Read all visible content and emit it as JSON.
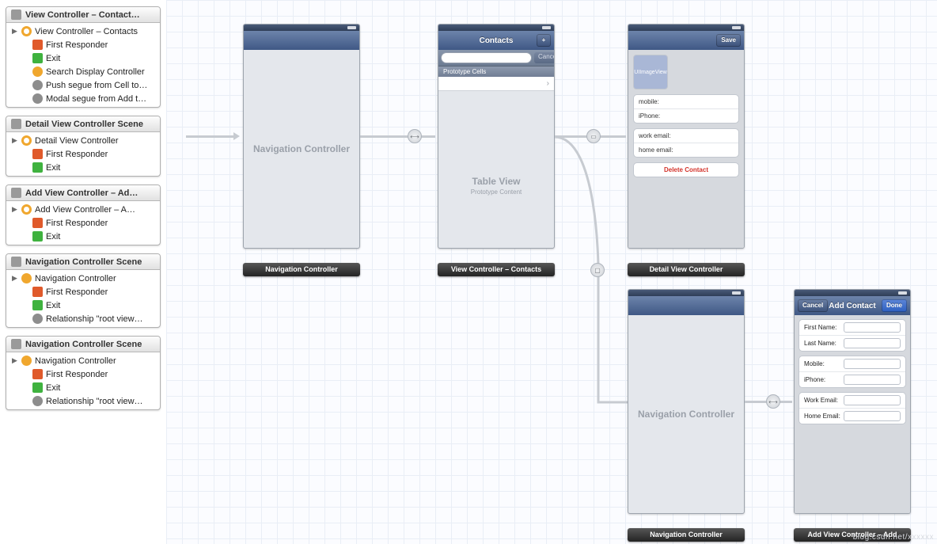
{
  "sidebar": {
    "scenes": [
      {
        "title": "View Controller – Contact…",
        "items": [
          {
            "icon": "vc",
            "label": "View Controller – Contacts",
            "tri": true
          },
          {
            "icon": "fr",
            "label": "First Responder"
          },
          {
            "icon": "exit",
            "label": "Exit"
          },
          {
            "icon": "search",
            "label": "Search Display Controller"
          },
          {
            "icon": "segue",
            "label": "Push segue from Cell to…"
          },
          {
            "icon": "segue",
            "label": "Modal segue from Add t…"
          }
        ]
      },
      {
        "title": "Detail View Controller Scene",
        "items": [
          {
            "icon": "vc",
            "label": "Detail View Controller",
            "tri": true
          },
          {
            "icon": "fr",
            "label": "First Responder"
          },
          {
            "icon": "exit",
            "label": "Exit"
          }
        ]
      },
      {
        "title": "Add View Controller – Ad…",
        "items": [
          {
            "icon": "vc",
            "label": "Add View Controller – A…",
            "tri": true
          },
          {
            "icon": "fr",
            "label": "First Responder"
          },
          {
            "icon": "exit",
            "label": "Exit"
          }
        ]
      },
      {
        "title": "Navigation Controller Scene",
        "items": [
          {
            "icon": "nav",
            "label": "Navigation Controller",
            "tri": true
          },
          {
            "icon": "fr",
            "label": "First Responder"
          },
          {
            "icon": "exit",
            "label": "Exit"
          },
          {
            "icon": "rel",
            "label": "Relationship \"root view…"
          }
        ]
      },
      {
        "title": "Navigation Controller Scene",
        "items": [
          {
            "icon": "nav",
            "label": "Navigation Controller",
            "tri": true
          },
          {
            "icon": "fr",
            "label": "First Responder"
          },
          {
            "icon": "exit",
            "label": "Exit"
          },
          {
            "icon": "rel",
            "label": "Relationship \"root view…"
          }
        ]
      }
    ]
  },
  "canvas": {
    "navController": {
      "placeholder": "Navigation Controller",
      "caption": "Navigation Controller"
    },
    "contacts": {
      "title": "Contacts",
      "plus": "+",
      "search_cancel": "Cancel",
      "proto_hdr": "Prototype Cells",
      "tv": "Table View",
      "tv_sub": "Prototype Content",
      "caption": "View Controller – Contacts",
      "chevron": "›"
    },
    "detail": {
      "save": "Save",
      "img": "UIImageView",
      "mobile": "mobile:",
      "iphone": "iPhone:",
      "work": "work email:",
      "home": "home email:",
      "delete": "Delete Contact",
      "caption": "Detail View Controller"
    },
    "nav2": {
      "placeholder": "Navigation Controller",
      "caption": "Navigation Controller"
    },
    "add": {
      "title": "Add Contact",
      "cancel": "Cancel",
      "done": "Done",
      "first": "First Name:",
      "last": "Last Name:",
      "mobile": "Mobile:",
      "iphone": "iPhone:",
      "work": "Work Email:",
      "home": "Home Email:",
      "caption": "Add View Controller – Add"
    }
  },
  "watermark": "blog.csdn.net/xxxxxx"
}
